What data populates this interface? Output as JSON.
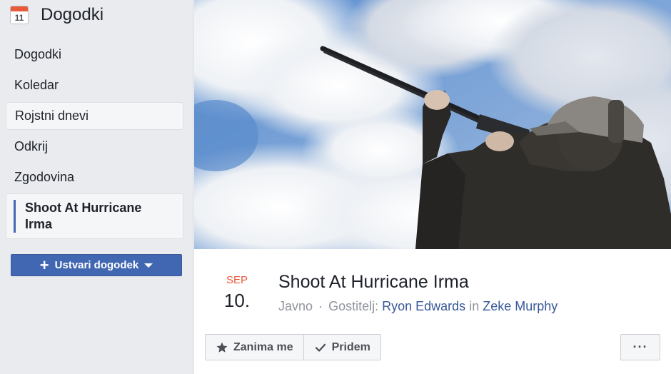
{
  "sidebar": {
    "title": "Dogodki",
    "calendar_icon_day": "11",
    "items": [
      {
        "label": "Dogodki"
      },
      {
        "label": "Koledar"
      },
      {
        "label": "Rojstni dnevi"
      },
      {
        "label": "Odkrij"
      },
      {
        "label": "Zgodovina"
      },
      {
        "label": "Shoot At Hurricane Irma"
      }
    ],
    "create_button": "Ustvari dogodek"
  },
  "event": {
    "month": "SEP",
    "day": "10.",
    "title": "Shoot At Hurricane Irma",
    "privacy": "Javno",
    "separator": "·",
    "host_label": "Gostitelj:",
    "host1": "Ryon Edwards",
    "and_word": "in",
    "host2": "Zeke Murphy",
    "cover_icon": "cover-photo-man-with-shotgun"
  },
  "actions": {
    "interested": "Zanima me",
    "going": "Pridem",
    "more": "···"
  },
  "colors": {
    "accent": "#4267b2",
    "date_red": "#e9593b",
    "link": "#385898"
  }
}
